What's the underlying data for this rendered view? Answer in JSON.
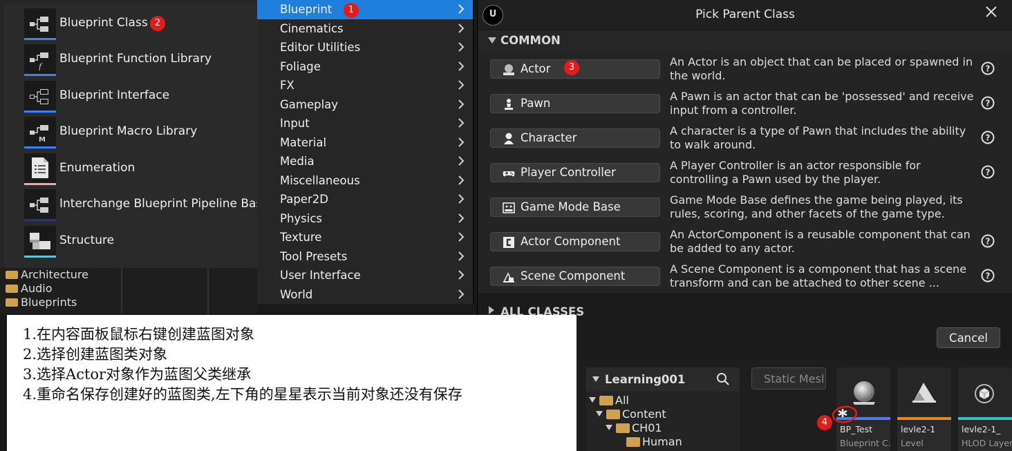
{
  "background": {
    "folders": [
      "Architecture",
      "Audio",
      "Blueprints"
    ]
  },
  "submenu": {
    "items": [
      {
        "label": "Blueprint Class",
        "icon": "blueprint-class-icon",
        "bar": "#3b82f6"
      },
      {
        "label": "Blueprint Function Library",
        "icon": "function-library-icon",
        "bar": "#3b82f6"
      },
      {
        "label": "Blueprint Interface",
        "icon": "blueprint-interface-icon",
        "bar": "#3b82f6"
      },
      {
        "label": "Blueprint Macro Library",
        "icon": "macro-library-icon",
        "bar": "#3b82f6"
      },
      {
        "label": "Enumeration",
        "icon": "enumeration-icon",
        "bar": "#f3a6a6"
      },
      {
        "label": "Interchange Blueprint Pipeline Base",
        "icon": "interchange-pipeline-icon",
        "bar": "#1c2f9a"
      },
      {
        "label": "Structure",
        "icon": "structure-icon",
        "bar": "#5bc8d8"
      }
    ]
  },
  "category_menu": {
    "selected": "Blueprint",
    "items": [
      "Blueprint",
      "Cinematics",
      "Editor Utilities",
      "Foliage",
      "FX",
      "Gameplay",
      "Input",
      "Material",
      "Media",
      "Miscellaneous",
      "Paper2D",
      "Physics",
      "Texture",
      "Tool Presets",
      "User Interface",
      "World"
    ]
  },
  "dialog": {
    "title": "Pick Parent Class",
    "logo_text": "U",
    "common_label": "COMMON",
    "all_classes_label": "ALL CLASSES",
    "cancel_label": "Cancel",
    "classes": [
      {
        "name": "Actor",
        "icon": "actor-icon",
        "desc": "An Actor is an object that can be placed or spawned in the world."
      },
      {
        "name": "Pawn",
        "icon": "pawn-icon",
        "desc": "A Pawn is an actor that can be 'possessed' and receive input from a controller."
      },
      {
        "name": "Character",
        "icon": "character-icon",
        "desc": "A character is a type of Pawn that includes the ability to walk around."
      },
      {
        "name": "Player Controller",
        "icon": "gamepad-icon",
        "desc": "A Player Controller is an actor responsible for controlling a Pawn used by the player."
      },
      {
        "name": "Game Mode Base",
        "icon": "game-mode-icon",
        "desc": "Game Mode Base defines the game being played, its rules, scoring, and other facets of the game type."
      },
      {
        "name": "Actor Component",
        "icon": "actor-component-icon",
        "desc": "An ActorComponent is a reusable component that can be added to any actor."
      },
      {
        "name": "Scene Component",
        "icon": "scene-component-icon",
        "desc": "A Scene Component is a component that has a scene transform and can be attached to other scene ..."
      }
    ]
  },
  "note": {
    "lines": [
      "1.在内容面板鼠标右键创建蓝图对象",
      "2.选择创建蓝图类对象",
      "3.选择Actor对象作为蓝图父类继承",
      "4.重命名保存创建好的蓝图类,左下角的星星表示当前对象还没有保存"
    ]
  },
  "content_browser": {
    "tree_title": "Learning001",
    "tree": [
      {
        "label": "All",
        "depth": 0
      },
      {
        "label": "Content",
        "depth": 1
      },
      {
        "label": "CH01",
        "depth": 2
      },
      {
        "label": "Human",
        "depth": 3
      }
    ],
    "search_placeholder": "Static Mesl",
    "tiles": [
      {
        "name": "BP_Test",
        "type": "Blueprint C...",
        "stripe": "#4a7ff0",
        "thumb": "sphere-icon"
      },
      {
        "name": "levle2-1",
        "type": "Level",
        "stripe": "#e88a1c",
        "thumb": "level-icon"
      },
      {
        "name": "levle2-1_",
        "type": "HLOD Layer",
        "stripe": "#2fc3c9",
        "thumb": "cube-icon"
      }
    ]
  },
  "markers": [
    "1",
    "2",
    "3",
    "4"
  ],
  "colors": {
    "selection": "#1f7fdd",
    "marker": "#e51b1b"
  }
}
